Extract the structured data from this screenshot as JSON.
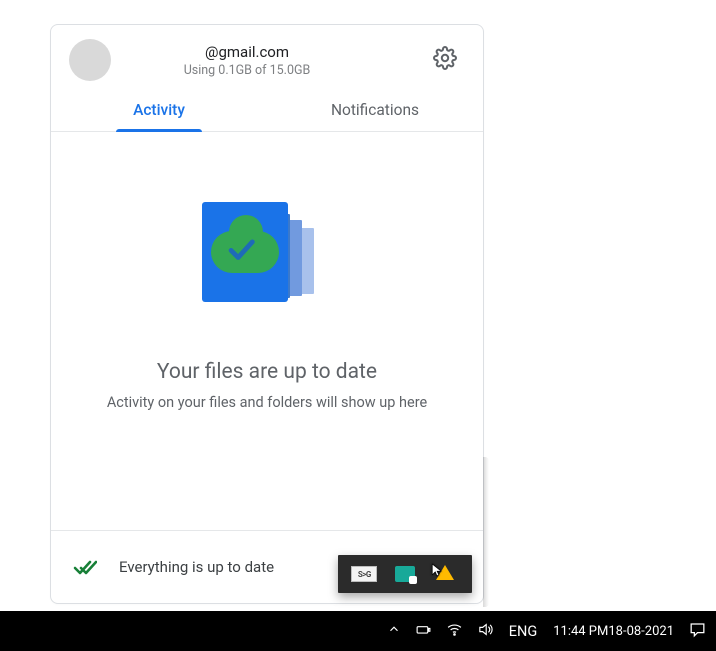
{
  "header": {
    "email": "@gmail.com",
    "usage": "Using 0.1GB of 15.0GB"
  },
  "tabs": {
    "activity": "Activity",
    "notifications": "Notifications"
  },
  "content": {
    "heading": "Your files are up to date",
    "sub": "Activity on your files and folders will show up here"
  },
  "footer": {
    "status": "Everything is up to date"
  },
  "tray": {
    "sg": "S>G"
  },
  "taskbar": {
    "language": "ENG",
    "time": "11:44 PM",
    "date": "18-08-2021"
  }
}
